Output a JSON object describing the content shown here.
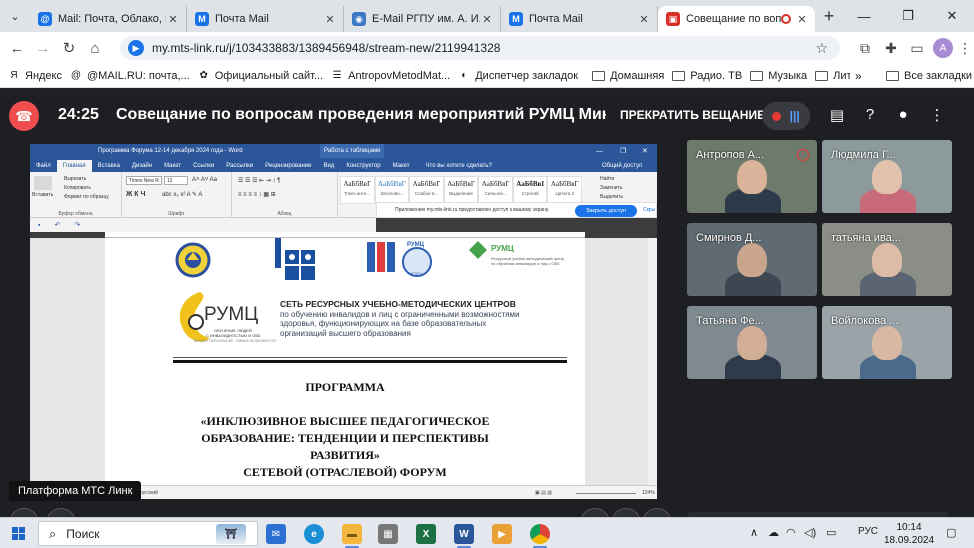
{
  "browser": {
    "tabs": [
      {
        "title": "Mail: Почта, Облако, Ка",
        "color": "#1a73e8",
        "glyph": "@",
        "active": false
      },
      {
        "title": "Почта Mail",
        "color": "#1a73e8",
        "glyph": "M",
        "active": false
      },
      {
        "title": "E-Mail РГПУ им. А. И. Ге",
        "color": "#3b78c4",
        "glyph": "◉",
        "active": false
      },
      {
        "title": "Почта Mail",
        "color": "#1a73e8",
        "glyph": "M",
        "active": false
      },
      {
        "title": "Совещание по вопр",
        "color": "#d93025",
        "glyph": "▣",
        "active": true
      }
    ],
    "url": "my.mts-link.ru/j/103433883/1389456948/stream-new/2119941328",
    "profile_initial": "A",
    "bookmarks": [
      {
        "label": "Яндекс",
        "type": "link"
      },
      {
        "label": "@MAIL.RU: почта,...",
        "type": "link"
      },
      {
        "label": "Официальный сайт...",
        "type": "link"
      },
      {
        "label": "AntropovMetodMat...",
        "type": "link"
      },
      {
        "label": "Диспетчер закладок",
        "type": "link"
      },
      {
        "label": "Домашняя",
        "type": "folder"
      },
      {
        "label": "Радио. ТВ",
        "type": "folder"
      },
      {
        "label": "Музыка",
        "type": "folder"
      },
      {
        "label": "Литература",
        "type": "folder"
      }
    ],
    "all_bookmarks": "Все закладки"
  },
  "meeting": {
    "timer": "24:25",
    "title": "Совещание по вопросам проведения мероприятий РУМЦ Минпр",
    "stop_broadcast": "ПРЕКРАТИТЬ ВЕЩАНИЕ",
    "platform_label": "Платформа МТС Линк",
    "participants": [
      {
        "name": "Антропов А...",
        "muted": true,
        "bg": "#6e7a6c"
      },
      {
        "name": "Людмила Г...",
        "muted": false,
        "bg": "#8d9a9b"
      },
      {
        "name": "Смирнов Д...",
        "muted": false,
        "bg": "#5f6a72"
      },
      {
        "name": "татьяна ива...",
        "muted": false,
        "bg": "#8a8e86"
      },
      {
        "name": "Татьяна Фе...",
        "muted": false,
        "bg": "#7f8a90"
      },
      {
        "name": "Войлокова ...",
        "muted": false,
        "bg": "#9aa3a8"
      }
    ]
  },
  "word": {
    "window_title": "Программа Форума 12-14 декабря 2024 года - Word",
    "table_tools": "Работа с таблицами",
    "ribbon_tabs": [
      "Файл",
      "Главная",
      "Вставка",
      "Дизайн",
      "Макет",
      "Ссылки",
      "Рассылки",
      "Рецензирование",
      "Вид",
      "Конструктор",
      "Макет"
    ],
    "tell_me": "Что вы хотите сделать?",
    "share": "Общий доступ",
    "clipboard": {
      "paste": "Вставить",
      "cut": "Вырезать",
      "copy": "Копировать",
      "format": "Формат по образцу",
      "label": "Буфер обмена"
    },
    "font": {
      "name": "Times New R",
      "size": "12",
      "label": "Шрифт"
    },
    "paragraph_label": "Абзац",
    "styles": [
      {
        "sample": "АаБбВвГ",
        "label": "¶ Без инте..."
      },
      {
        "sample": "АаБбВвГ",
        "label": "Заголово..."
      },
      {
        "sample": "АаБбВвГ",
        "label": "Слабое в..."
      },
      {
        "sample": "АаБбВвГ",
        "label": "Выделение"
      },
      {
        "sample": "АаБбВвГ",
        "label": "Сильное..."
      },
      {
        "sample": "АаБбВвI",
        "label": "Строгий"
      },
      {
        "sample": "АаБбВвГ",
        "label": "Цитата 2"
      }
    ],
    "editing": {
      "find": "Найти",
      "replace": "Заменить",
      "select": "Выделить"
    },
    "notice": "Приложению my.mts-link.ru предоставлен доступ к вашему экрану.",
    "allow": "Закрыть доступ",
    "hide": "Скры",
    "status_lang": "русский",
    "zoom": "124%",
    "logos": {
      "rumc_small": "РУМЦ",
      "rumc_small_sub": "МГППУ",
      "rumc_green": "РУМЦ",
      "rumc_green_sub": "Ресурсный учебно-методический центр по обучению инвалидов и лиц с ОВЗ",
      "rumc_big": "РУМЦ",
      "rumc_big_sub1": "ОБУЧЕНИЕ ЛЮДЕЙ",
      "rumc_big_sub2": "С ИНВАЛИДНОСТЬЮ И ОВЗ",
      "rumc_big_sub3": "ВЫСШЕЕ ОБРАЗОВАНИЕ - РАВНЫЕ ВОЗМОЖНОСТИ"
    },
    "network_title": "СЕТЬ РЕСУРСНЫХ УЧЕБНО-МЕТОДИЧЕСКИХ ЦЕНТРОВ",
    "network_lines": [
      "по обучению инвалидов и лиц с ограниченными возможностями",
      "здоровья, функционирующих на базе образовательных",
      "организаций высшего образования"
    ],
    "heading_program": "ПРОГРАММА",
    "heading_lines": [
      "«ИНКЛЮЗИВНОЕ ВЫСШЕЕ ПЕДАГОГИЧЕСКОЕ",
      "ОБРАЗОВАНИЕ: ТЕНДЕНЦИИ И ПЕРСПЕКТИВЫ",
      "РАЗВИТИЯ»",
      "СЕТЕВОЙ (ОТРАСЛЕВОЙ) ФОРУМ"
    ]
  },
  "taskbar": {
    "search": "Поиск",
    "lang": "РУС",
    "time": "10:14",
    "date": "18.09.2024"
  }
}
